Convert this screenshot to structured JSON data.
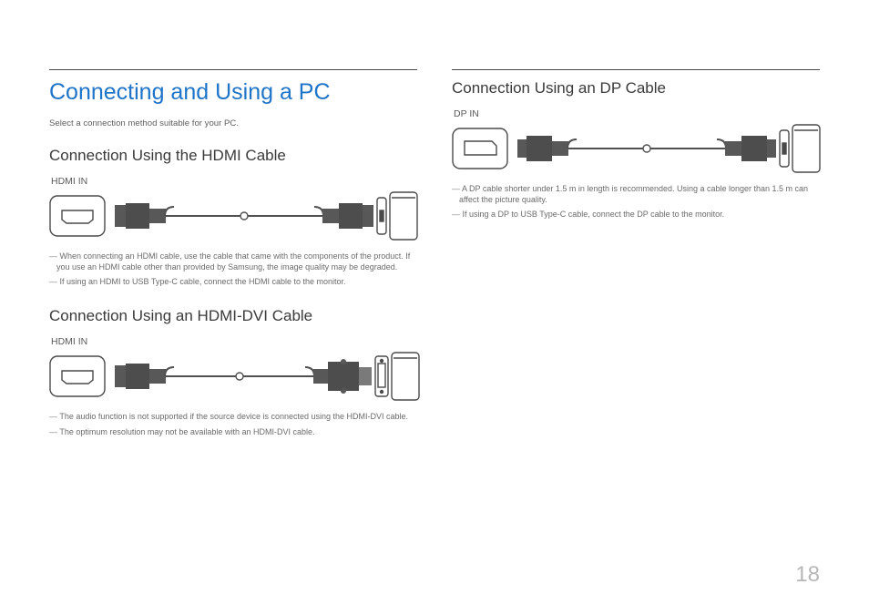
{
  "page": {
    "title": "Connecting and Using a PC",
    "intro": "Select a connection method suitable for your PC.",
    "number": "18"
  },
  "sections": {
    "hdmi": {
      "heading": "Connection Using the HDMI Cable",
      "port_label": "HDMI IN",
      "notes": [
        "When connecting an HDMI cable, use the cable that came with the components of the product. If you use an HDMI cable other than provided by Samsung, the image quality may be degraded.",
        "If using an HDMI to USB Type-C cable, connect the HDMI cable to the monitor."
      ]
    },
    "hdmi_dvi": {
      "heading": "Connection Using an HDMI-DVI Cable",
      "port_label": "HDMI IN",
      "notes": [
        "The audio function is not supported if the source device is connected using the HDMI-DVI cable.",
        "The optimum resolution may not be available with an HDMI-DVI cable."
      ]
    },
    "dp": {
      "heading": "Connection Using an DP Cable",
      "port_label": "DP IN",
      "notes": [
        "A DP cable shorter under 1.5 m in length is recommended. Using a cable longer than 1.5 m can affect the picture quality.",
        "If using a DP to USB Type-C cable, connect the DP cable to the monitor."
      ]
    }
  }
}
